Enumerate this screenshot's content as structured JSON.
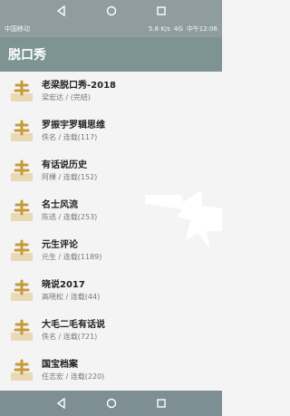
{
  "status": {
    "carrier": "中国移动",
    "speed": "5.8 K/s",
    "time": "中午12:06",
    "signal": "4G"
  },
  "appbar": {
    "title": "脱口秀"
  },
  "items": [
    {
      "title": "老梁脱口秀-2018",
      "subtitle": "梁宏达 / (完结)"
    },
    {
      "title": "罗振宇罗辑思维",
      "subtitle": "佚名 / 连载(117)"
    },
    {
      "title": "有话说历史",
      "subtitle": "阿棵 / 连载(152)"
    },
    {
      "title": "名士风流",
      "subtitle": "陈逃 / 连载(253)"
    },
    {
      "title": "元生评论",
      "subtitle": "元生 / 连载(1189)"
    },
    {
      "title": "晓说2017",
      "subtitle": "高晓松 / 连载(44)"
    },
    {
      "title": "大毛二毛有话说",
      "subtitle": "佚名 / 连载(721)"
    },
    {
      "title": "国宝档案",
      "subtitle": "任志宏 / 连载(220)"
    }
  ],
  "colors": {
    "appbar": "#7e9493",
    "list_bg": "#f4f4f4",
    "icon_gold": "#c69a3b"
  }
}
